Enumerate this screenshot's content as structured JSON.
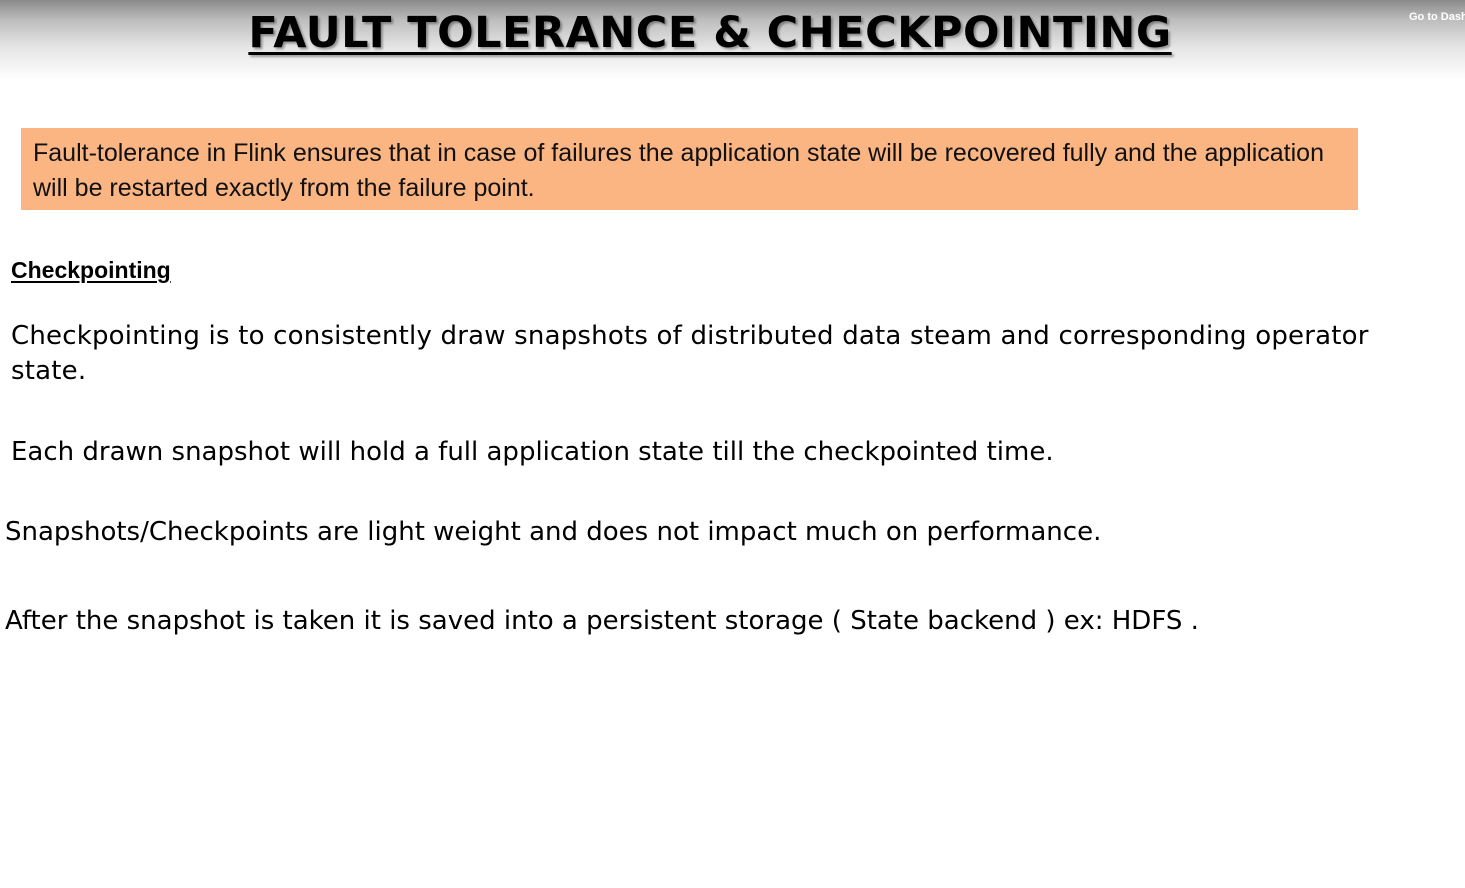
{
  "header": {
    "title": "FAULT TOLERANCE & CHECKPOINTING",
    "goto_link": "Go to Dash"
  },
  "callout": {
    "text": "Fault-tolerance in Flink ensures that in case of failures the application state will be recovered fully and the application will be restarted exactly from the failure point.",
    "background_color": "#fbb582"
  },
  "section": {
    "heading": "Checkpointing",
    "paragraphs": [
      "Checkpointing is to consistently draw snapshots of distributed data steam and corresponding operator state.",
      "Each drawn snapshot will hold a full application state till the checkpointed time.",
      "Snapshots/Checkpoints are light weight and does not impact much on performance.",
      "After the snapshot is taken it is saved into a persistent storage ( State backend ) ex: HDFS ."
    ]
  }
}
